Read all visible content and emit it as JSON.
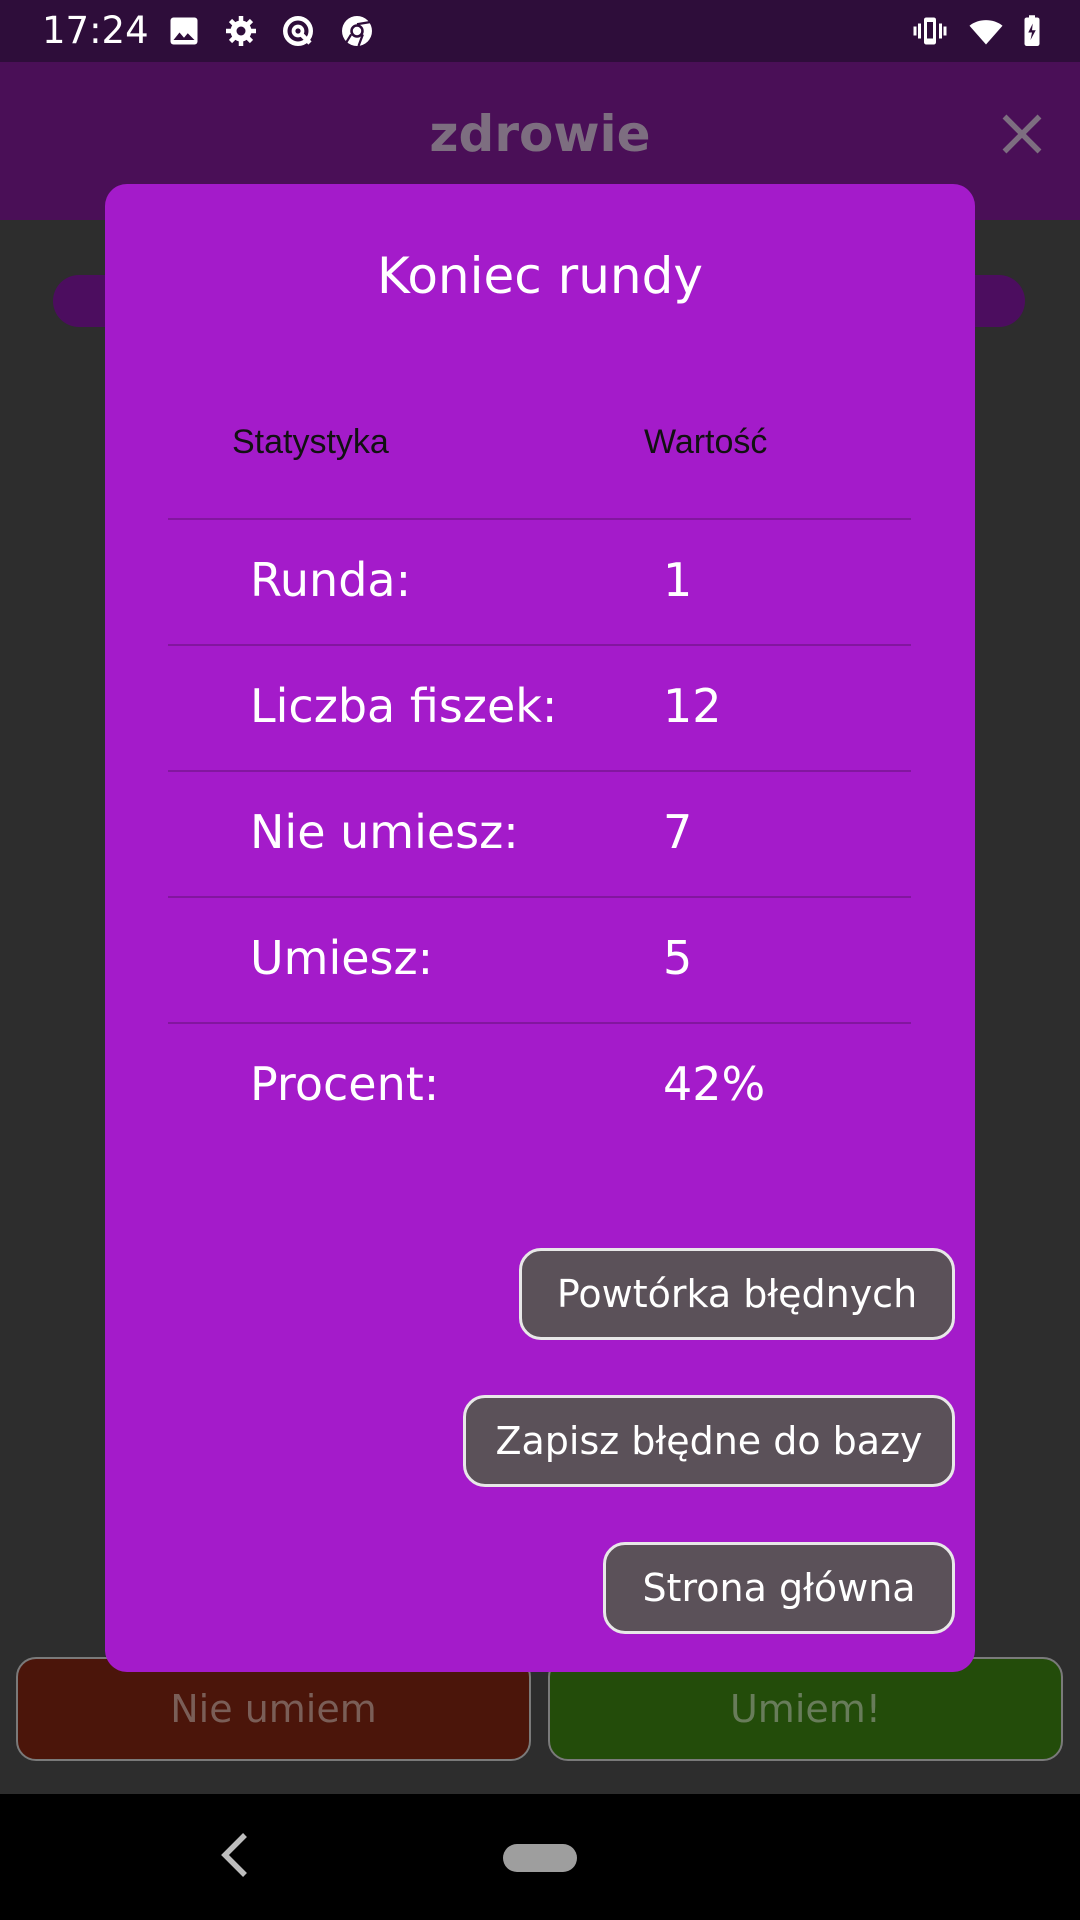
{
  "status_bar": {
    "time": "17:24",
    "left_icons": [
      "image-icon",
      "gear-icon",
      "data-saver-icon",
      "chrome-icon"
    ],
    "right_icons": [
      "vibrate-icon",
      "wifi-icon",
      "battery-charging-icon"
    ]
  },
  "app_bar": {
    "title": "zdrowie",
    "close_icon": "close-icon"
  },
  "dialog": {
    "title": "Koniec rundy",
    "columns": {
      "stat": "Statystyka",
      "value": "Wartość"
    },
    "rows": [
      {
        "label": "Runda:",
        "value": "1"
      },
      {
        "label": "Liczba fiszek:",
        "value": "12"
      },
      {
        "label": "Nie umiesz:",
        "value": "7"
      },
      {
        "label": "Umiesz:",
        "value": "5"
      },
      {
        "label": "Procent:",
        "value": "42%"
      }
    ],
    "buttons": {
      "repeat_wrong": "Powtórka błędnych",
      "save_wrong": "Zapisz błędne do bazy",
      "home": "Strona główna"
    }
  },
  "answer_buttons": {
    "dont_know": "Nie umiem",
    "know": "Umiem!"
  },
  "colors": {
    "dialog_bg": "#a41bca",
    "app_bar_bg": "#4a0f57",
    "button_bg": "#5b5159",
    "dont_know_bg": "#4b150a",
    "know_bg": "#234c0a"
  }
}
